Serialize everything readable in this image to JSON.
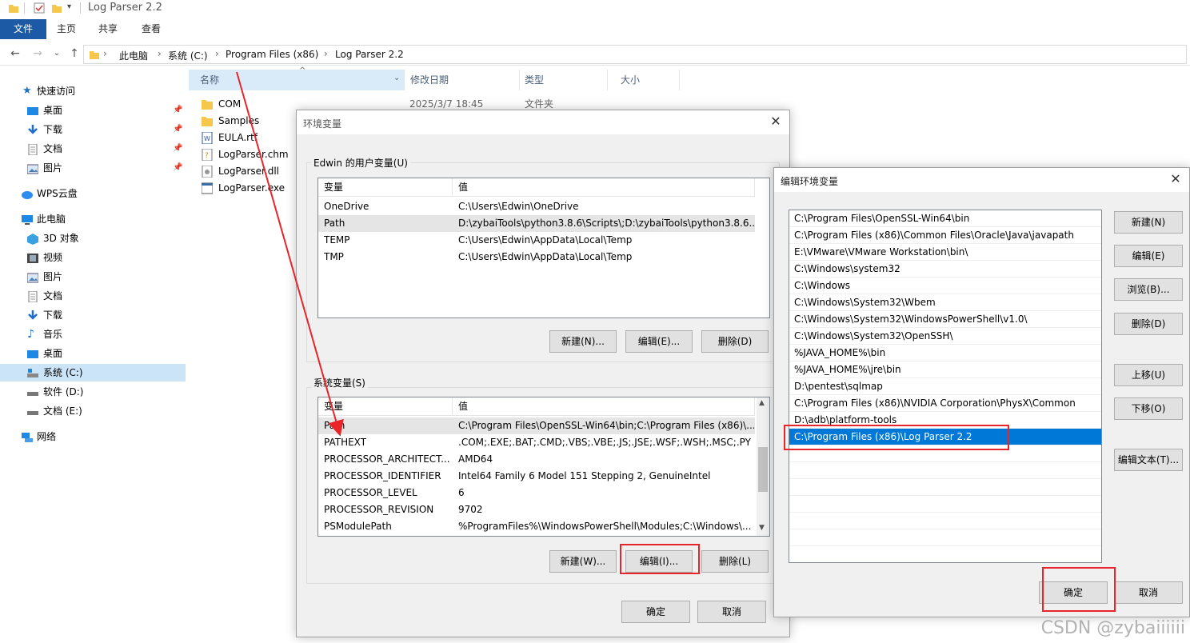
{
  "window": {
    "title": "Log Parser 2.2"
  },
  "ribbon": {
    "tabs": [
      "文件",
      "主页",
      "共享",
      "查看"
    ]
  },
  "address": {
    "crumbs": [
      "此电脑",
      "系统 (C:)",
      "Program Files (x86)",
      "Log Parser 2.2"
    ]
  },
  "nav": {
    "quick_access": "快速访问",
    "quick_items": [
      "桌面",
      "下载",
      "文档",
      "图片"
    ],
    "wps": "WPS云盘",
    "this_pc": "此电脑",
    "pc_items": [
      "3D 对象",
      "视频",
      "图片",
      "文档",
      "下载",
      "音乐",
      "桌面",
      "系统 (C:)",
      "软件 (D:)",
      "文档 (E:)"
    ],
    "network": "网络"
  },
  "files": {
    "columns": [
      "名称",
      "修改日期",
      "类型",
      "大小"
    ],
    "rows": [
      {
        "name": "COM",
        "date": "2025/3/7 18:45",
        "type": "文件夹"
      },
      {
        "name": "Samples"
      },
      {
        "name": "EULA.rtf"
      },
      {
        "name": "LogParser.chm"
      },
      {
        "name": "LogParser.dll"
      },
      {
        "name": "LogParser.exe"
      }
    ]
  },
  "env_dialog": {
    "title": "环境变量",
    "user_group": "Edwin 的用户变量(U)",
    "col_var": "变量",
    "col_val": "值",
    "user_vars": [
      {
        "name": "OneDrive",
        "value": "C:\\Users\\Edwin\\OneDrive"
      },
      {
        "name": "Path",
        "value": "D:\\zybaiTools\\python3.8.6\\Scripts\\;D:\\zybaiTools\\python3.8.6..."
      },
      {
        "name": "TEMP",
        "value": "C:\\Users\\Edwin\\AppData\\Local\\Temp"
      },
      {
        "name": "TMP",
        "value": "C:\\Users\\Edwin\\AppData\\Local\\Temp"
      }
    ],
    "user_buttons": [
      "新建(N)...",
      "编辑(E)...",
      "删除(D)"
    ],
    "sys_group": "系统变量(S)",
    "sys_vars": [
      {
        "name": "Path",
        "value": "C:\\Program Files\\OpenSSL-Win64\\bin;C:\\Program Files (x86)\\..."
      },
      {
        "name": "PATHEXT",
        "value": ".COM;.EXE;.BAT;.CMD;.VBS;.VBE;.JS;.JSE;.WSF;.WSH;.MSC;.PY"
      },
      {
        "name": "PROCESSOR_ARCHITECT...",
        "value": "AMD64"
      },
      {
        "name": "PROCESSOR_IDENTIFIER",
        "value": "Intel64 Family 6 Model 151 Stepping 2, GenuineIntel"
      },
      {
        "name": "PROCESSOR_LEVEL",
        "value": "6"
      },
      {
        "name": "PROCESSOR_REVISION",
        "value": "9702"
      },
      {
        "name": "PSModulePath",
        "value": "%ProgramFiles%\\WindowsPowerShell\\Modules;C:\\Windows\\..."
      }
    ],
    "sys_buttons": [
      "新建(W)...",
      "编辑(I)...",
      "删除(L)"
    ],
    "ok": "确定",
    "cancel": "取消"
  },
  "edit_dialog": {
    "title": "编辑环境变量",
    "entries": [
      "C:\\Program Files\\OpenSSL-Win64\\bin",
      "C:\\Program Files (x86)\\Common Files\\Oracle\\Java\\javapath",
      "E:\\VMware\\VMware Workstation\\bin\\",
      "C:\\Windows\\system32",
      "C:\\Windows",
      "C:\\Windows\\System32\\Wbem",
      "C:\\Windows\\System32\\WindowsPowerShell\\v1.0\\",
      "C:\\Windows\\System32\\OpenSSH\\",
      "%JAVA_HOME%\\bin",
      "%JAVA_HOME%\\jre\\bin",
      "D:\\pentest\\sqlmap",
      "C:\\Program Files (x86)\\NVIDIA Corporation\\PhysX\\Common",
      "D:\\adb\\platform-tools",
      "C:\\Program Files (x86)\\Log Parser 2.2"
    ],
    "buttons": [
      "新建(N)",
      "编辑(E)",
      "浏览(B)...",
      "删除(D)",
      "上移(U)",
      "下移(O)",
      "编辑文本(T)..."
    ],
    "ok": "确定",
    "cancel": "取消"
  },
  "watermark": "CSDN @zybaiiiiii",
  "colors": {
    "accent": "#0078d7",
    "annotation": "#e8262a",
    "file_tab": "#1c5aa6"
  }
}
